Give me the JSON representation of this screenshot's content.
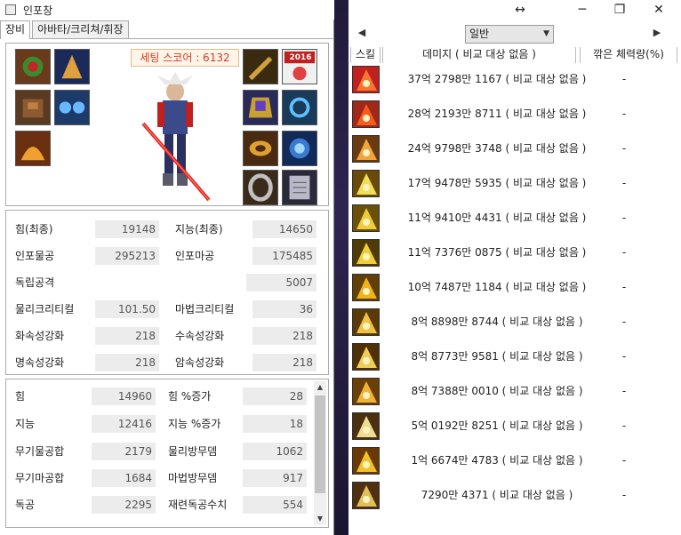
{
  "window": {
    "title": "인포창"
  },
  "tabs": [
    {
      "label": "장비"
    },
    {
      "label": "아바타/크리쳐/휘장"
    }
  ],
  "equip": {
    "score_label": "세팅 스코어 : 6132",
    "badge_2016": "2016"
  },
  "stats1": [
    {
      "l1": "힘(최종)",
      "v1": "19148",
      "l2": "지능(최종)",
      "v2": "14650"
    },
    {
      "l1": "인포물공",
      "v1": "295213",
      "l2": "인포마공",
      "v2": "175485"
    },
    {
      "l1": "독립공격",
      "v1": "",
      "l2": "",
      "v2": "5007"
    },
    {
      "l1": "물리크리티컬",
      "v1": "101.50",
      "l2": "마법크리티컬",
      "v2": "36"
    },
    {
      "l1": "화속성강화",
      "v1": "218",
      "l2": "수속성강화",
      "v2": "218"
    },
    {
      "l1": "명속성강화",
      "v1": "218",
      "l2": "암속성강화",
      "v2": "218"
    }
  ],
  "stats2": [
    {
      "l1": "힘",
      "v1": "14960",
      "l2": "힘 %증가",
      "v2": "28"
    },
    {
      "l1": "지능",
      "v1": "12416",
      "l2": "지능 %증가",
      "v2": "18"
    },
    {
      "l1": "무기물공합",
      "v1": "2179",
      "l2": "물리방무뎀",
      "v2": "1062"
    },
    {
      "l1": "무기마공합",
      "v1": "1684",
      "l2": "마법방무뎀",
      "v2": "917"
    },
    {
      "l1": "독공",
      "v1": "2295",
      "l2": "재련독공수치",
      "v2": "554"
    }
  ],
  "right": {
    "mode": "일반",
    "columns": {
      "skill": "스킬",
      "damage": "데미지 ( 비교 대상 없음 )",
      "hp": "깎은 체력량(%)"
    },
    "rows": [
      {
        "damage": "37억 2798만 1167 ( 비교 대상 없음 )",
        "hp": "-"
      },
      {
        "damage": "28억 2193만 8711 ( 비교 대상 없음 )",
        "hp": "-"
      },
      {
        "damage": "24억 9798만 3748 ( 비교 대상 없음 )",
        "hp": "-"
      },
      {
        "damage": "17억 9478만 5935 ( 비교 대상 없음 )",
        "hp": "-"
      },
      {
        "damage": "11억 9410만 4431 ( 비교 대상 없음 )",
        "hp": "-"
      },
      {
        "damage": "11억 7376만 0875 ( 비교 대상 없음 )",
        "hp": "-"
      },
      {
        "damage": "10억 7487만 1184 ( 비교 대상 없음 )",
        "hp": "-"
      },
      {
        "damage": "8억 8898만 8744 ( 비교 대상 없음 )",
        "hp": "-"
      },
      {
        "damage": "8억 8773만 9581 ( 비교 대상 없음 )",
        "hp": "-"
      },
      {
        "damage": "8억 7388만 0010 ( 비교 대상 없음 )",
        "hp": "-"
      },
      {
        "damage": "5억 0192만 8251 ( 비교 대상 없음 )",
        "hp": "-"
      },
      {
        "damage": "1억 6674만 4783 ( 비교 대상 없음 )",
        "hp": "-"
      },
      {
        "damage": "7290만 4371 ( 비교 대상 없음 )",
        "hp": "-"
      }
    ]
  },
  "colors": {
    "score_text": "#d53a22",
    "score_bg": "#fff5e8",
    "value_bg": "#ececec"
  }
}
